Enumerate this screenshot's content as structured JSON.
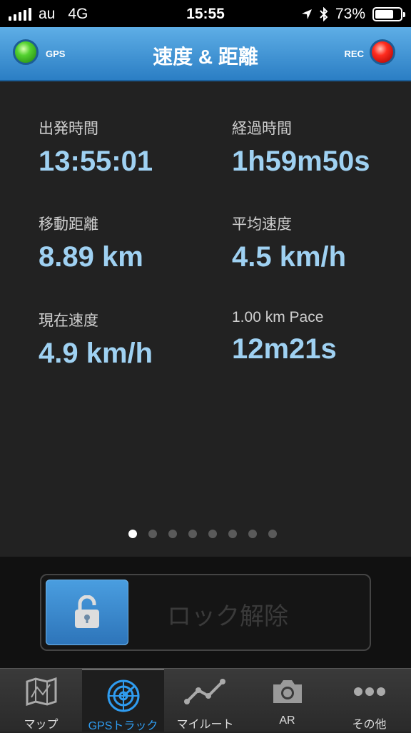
{
  "status": {
    "carrier": "au",
    "network": "4G",
    "time": "15:55",
    "battery": "73%",
    "battery_level": 0.73
  },
  "nav": {
    "title": "速度 & 距離",
    "gps_label": "GPS",
    "rec_label": "REC"
  },
  "stats": [
    {
      "label": "出発時間",
      "value": "13:55:01"
    },
    {
      "label": "経過時間",
      "value": "1h59m50s"
    },
    {
      "label": "移動距離",
      "value": "8.89 km"
    },
    {
      "label": "平均速度",
      "value": "4.5 km/h"
    },
    {
      "label": "現在速度",
      "value": "4.9 km/h"
    },
    {
      "label": "1.00 km Pace",
      "value": "12m21s"
    }
  ],
  "pager": {
    "count": 8,
    "active": 0
  },
  "lock": {
    "label": "ロック解除"
  },
  "tabs": [
    {
      "label": "マップ",
      "icon": "map-icon"
    },
    {
      "label": "GPSトラック",
      "icon": "radar-icon"
    },
    {
      "label": "マイルート",
      "icon": "route-icon"
    },
    {
      "label": "AR",
      "icon": "camera-icon"
    },
    {
      "label": "その他",
      "icon": "more-icon"
    }
  ],
  "colors": {
    "accent": "#2f9cf0",
    "value_text": "#9fd1f2",
    "nav_bar": "#3d8fd2",
    "gps_led": "#53d12f",
    "rec_led": "#ff2d1f"
  }
}
